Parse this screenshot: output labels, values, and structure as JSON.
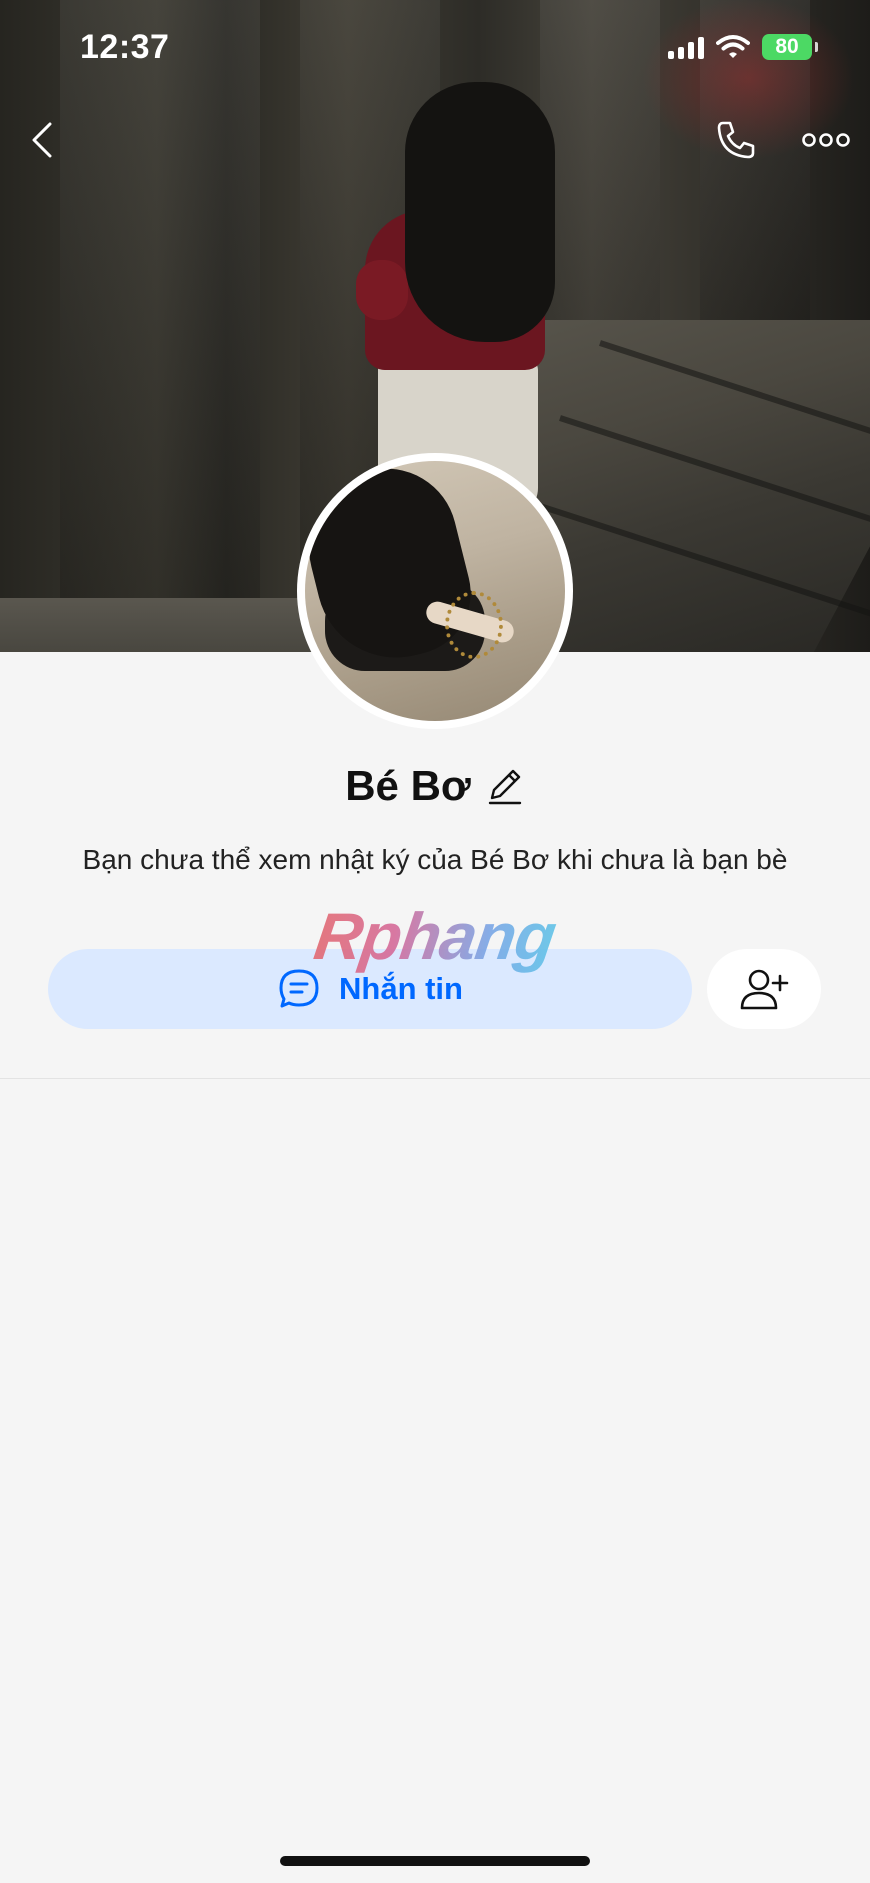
{
  "status_bar": {
    "time": "12:37",
    "battery": "80"
  },
  "header": {
    "back_icon": "chevron-left-icon",
    "call_icon": "phone-icon",
    "more_icon": "more-dots-icon"
  },
  "profile": {
    "name": "Bé Bơ",
    "edit_icon": "pencil-icon",
    "notice": "Bạn chưa thể xem nhật ký của Bé Bơ khi chưa là bạn bè"
  },
  "actions": {
    "message_label": "Nhắn tin",
    "message_icon": "chat-bubble-icon",
    "add_friend_icon": "add-user-icon"
  },
  "watermark": {
    "text": "Rphang"
  },
  "colors": {
    "accent": "#0068ff",
    "message_button_bg": "#dbe9ff",
    "battery_green": "#4cd964",
    "background": "#f5f5f5"
  }
}
